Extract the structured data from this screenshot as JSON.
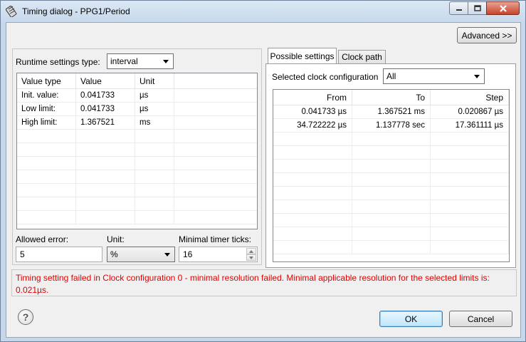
{
  "window": {
    "title": "Timing dialog - PPG1/Period"
  },
  "buttons": {
    "advanced": "Advanced >>",
    "ok": "OK",
    "cancel": "Cancel"
  },
  "runtime": {
    "type_label": "Runtime settings type:",
    "type_value": "interval",
    "table": {
      "headers": [
        "Value type",
        "Value",
        "Unit"
      ],
      "rows": [
        [
          "Init. value:",
          "0.041733",
          "µs"
        ],
        [
          "Low limit:",
          "0.041733",
          "µs"
        ],
        [
          "High limit:",
          "1.367521",
          "ms"
        ]
      ]
    }
  },
  "error_settings": {
    "allowed_error_label": "Allowed error:",
    "allowed_error_value": "5",
    "unit_label": "Unit:",
    "unit_value": "%",
    "min_ticks_label": "Minimal timer ticks:",
    "min_ticks_value": "16"
  },
  "tabs": {
    "possible_settings": "Possible settings",
    "clock_path": "Clock path"
  },
  "possible": {
    "clock_config_label": "Selected clock configuration",
    "clock_config_value": "All",
    "table": {
      "headers": [
        "From",
        "To",
        "Step"
      ],
      "rows": [
        [
          "0.041733 µs",
          "1.367521 ms",
          "0.020867 µs"
        ],
        [
          "34.722222 µs",
          "1.137778 sec",
          "17.361111 µs"
        ]
      ]
    }
  },
  "error_message": "Timing setting failed in Clock configuration 0 - minimal resolution failed. Minimal applicable resolution for the selected limits is: 0.021µs."
}
